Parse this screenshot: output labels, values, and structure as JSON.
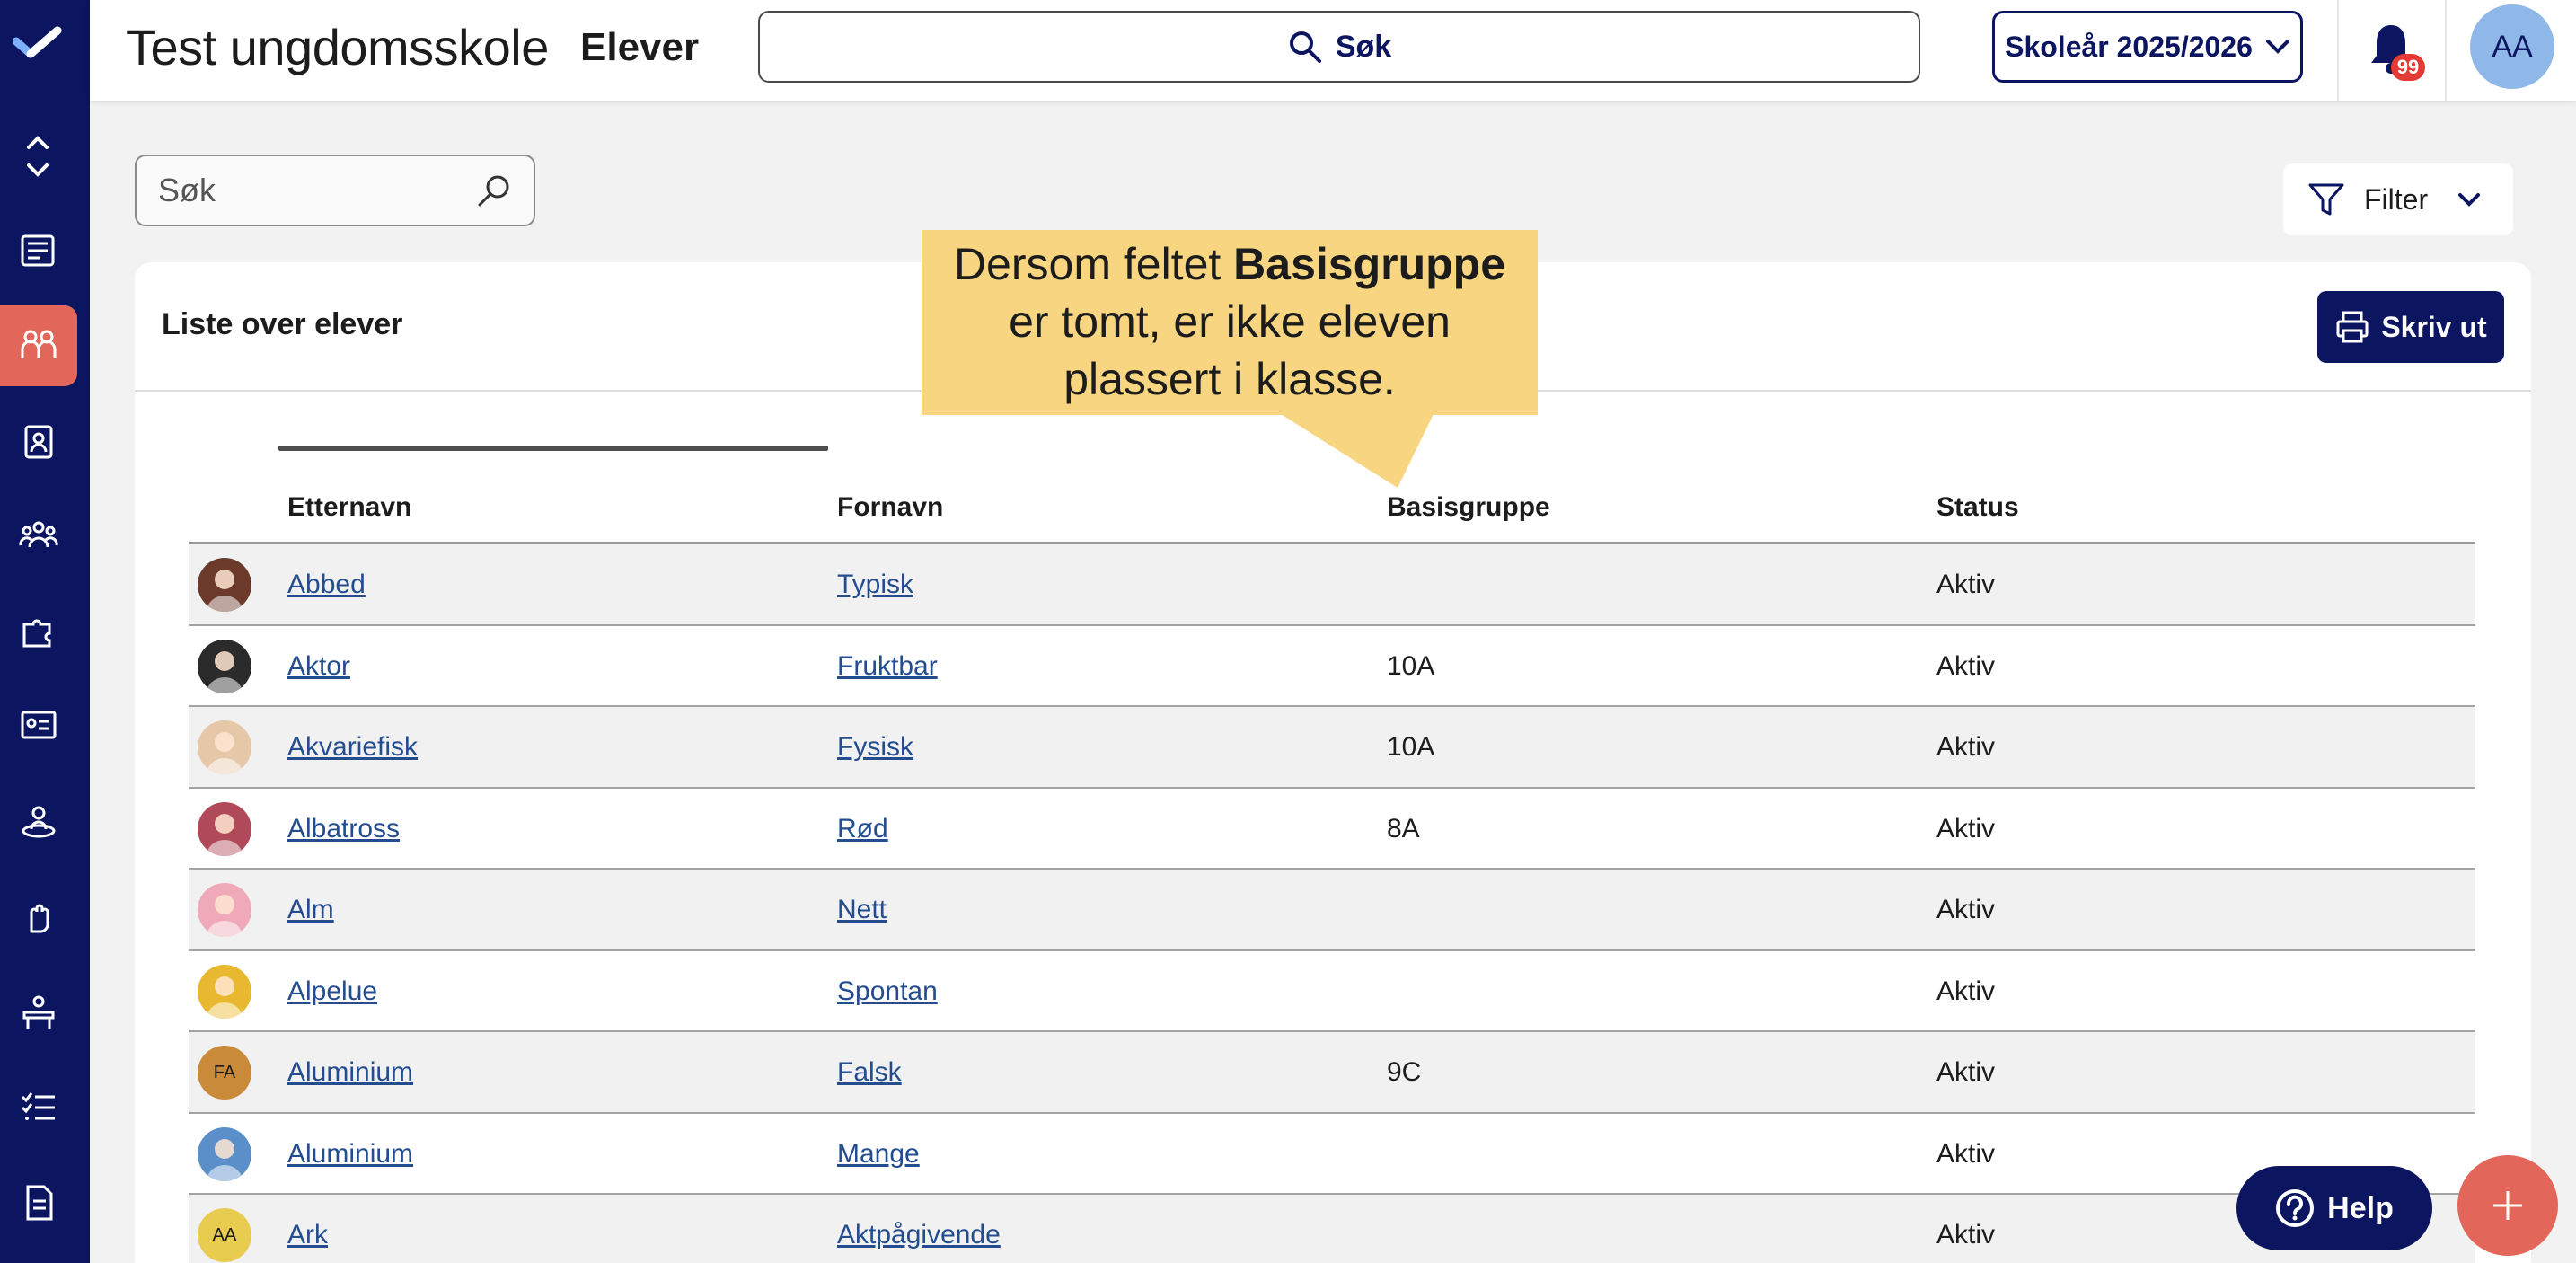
{
  "header": {
    "school": "Test ungdomsskole",
    "page": "Elever",
    "search_label": "Søk",
    "year_label": "Skoleår 2025/2026",
    "notification_count": "99",
    "user_initials": "AA"
  },
  "rail": {
    "items": [
      "newspaper-icon",
      "students-icon",
      "id-badge-icon",
      "groups-icon",
      "puzzle-icon",
      "chalkboard-icon",
      "person-ring-icon",
      "hand-icon",
      "desk-icon",
      "checklist-icon",
      "document-icon"
    ],
    "active": "students-icon"
  },
  "search": {
    "placeholder": "Søk"
  },
  "filter": {
    "label": "Filter"
  },
  "card": {
    "title": "Liste over elever",
    "print_label": "Skriv ut"
  },
  "tooltip": {
    "line1_prefix": "Dersom feltet ",
    "line1_bold": "Basisgruppe",
    "line2": "er tomt, er ikke eleven",
    "line3": "plassert i klasse."
  },
  "table": {
    "columns": [
      "Etternavn",
      "Fornavn",
      "Basisgruppe",
      "Status"
    ],
    "rows": [
      {
        "last": "Abbed",
        "first": "Typisk",
        "group": "",
        "status": "Aktiv",
        "avatar": "",
        "avatar_color": "#6b3a2a"
      },
      {
        "last": "Aktor",
        "first": "Fruktbar",
        "group": "10A",
        "status": "Aktiv",
        "avatar": "",
        "avatar_color": "#2b2b2b"
      },
      {
        "last": "Akvariefisk",
        "first": "Fysisk",
        "group": "10A",
        "status": "Aktiv",
        "avatar": "",
        "avatar_color": "#e6c7a8"
      },
      {
        "last": "Albatross",
        "first": "Rød",
        "group": "8A",
        "status": "Aktiv",
        "avatar": "",
        "avatar_color": "#b04a5a"
      },
      {
        "last": "Alm",
        "first": "Nett",
        "group": "",
        "status": "Aktiv",
        "avatar": "",
        "avatar_color": "#f0a9b8"
      },
      {
        "last": "Alpelue",
        "first": "Spontan",
        "group": "",
        "status": "Aktiv",
        "avatar": "",
        "avatar_color": "#e8b830"
      },
      {
        "last": "Aluminium",
        "first": "Falsk",
        "group": "9C",
        "status": "Aktiv",
        "avatar": "FA",
        "avatar_color": "#c98a3a"
      },
      {
        "last": "Aluminium",
        "first": "Mange",
        "group": "",
        "status": "Aktiv",
        "avatar": "",
        "avatar_color": "#5a8fc9"
      },
      {
        "last": "Ark",
        "first": "Aktpågivende",
        "group": "",
        "status": "Aktiv",
        "avatar": "AA",
        "avatar_color": "#e8cc50"
      }
    ]
  },
  "help": {
    "label": "Help"
  }
}
